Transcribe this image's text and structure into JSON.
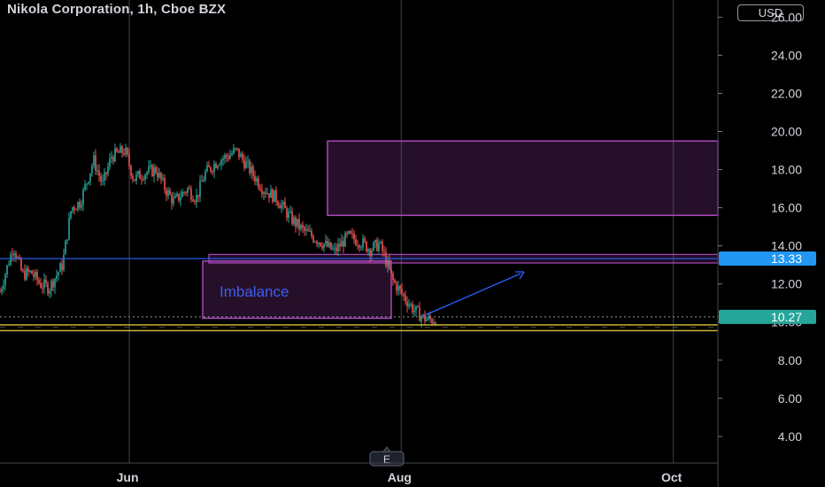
{
  "header": {
    "title": "Nikola Corporation, 1h, Cboe BZX",
    "currency": "USD"
  },
  "colors": {
    "up": "#26a69a",
    "down": "#ef5350",
    "zone": "#ab47bc",
    "hline": "#2962ff",
    "support": "#d4c33a",
    "price_tag": "#26a69a",
    "level_tag": "#2196f3"
  },
  "chart_data": {
    "type": "candlestick",
    "ylim": [
      2.6,
      26.9
    ],
    "y_ticks": [
      "26.00",
      "24.00",
      "22.00",
      "20.00",
      "18.00",
      "16.00",
      "14.00",
      "12.00",
      "10.00",
      "8.00",
      "6.00",
      "4.00"
    ],
    "x_ticks": [
      "Jun",
      "Aug",
      "Oct"
    ],
    "xlim": [
      "2021-05-03",
      "2021-10-11"
    ],
    "price_path": [
      [
        "2021-05-03",
        11.6
      ],
      [
        "2021-05-05",
        13.2
      ],
      [
        "2021-05-06",
        14.0
      ],
      [
        "2021-05-08",
        12.5
      ],
      [
        "2021-05-10",
        12.6
      ],
      [
        "2021-05-12",
        12.0
      ],
      [
        "2021-05-14",
        11.8
      ],
      [
        "2021-05-17",
        13.0
      ],
      [
        "2021-05-19",
        16.0
      ],
      [
        "2021-05-21",
        16.3
      ],
      [
        "2021-05-24",
        18.5
      ],
      [
        "2021-05-26",
        17.2
      ],
      [
        "2021-05-28",
        18.7
      ],
      [
        "2021-05-31",
        19.0
      ],
      [
        "2021-06-02",
        17.5
      ],
      [
        "2021-06-04",
        17.8
      ],
      [
        "2021-06-07",
        18.0
      ],
      [
        "2021-06-09",
        17.0
      ],
      [
        "2021-06-11",
        16.3
      ],
      [
        "2021-06-14",
        17.0
      ],
      [
        "2021-06-16",
        16.5
      ],
      [
        "2021-06-18",
        17.8
      ],
      [
        "2021-06-21",
        18.5
      ],
      [
        "2021-06-23",
        18.7
      ],
      [
        "2021-06-25",
        19.0
      ],
      [
        "2021-06-28",
        18.0
      ],
      [
        "2021-07-01",
        17.0
      ],
      [
        "2021-07-04",
        16.5
      ],
      [
        "2021-07-07",
        15.5
      ],
      [
        "2021-07-10",
        14.8
      ],
      [
        "2021-07-14",
        14.2
      ],
      [
        "2021-07-17",
        13.7
      ],
      [
        "2021-07-20",
        14.5
      ],
      [
        "2021-07-23",
        14.2
      ],
      [
        "2021-07-25",
        13.8
      ],
      [
        "2021-07-27",
        14.1
      ],
      [
        "2021-07-28",
        13.6
      ],
      [
        "2021-07-30",
        12.2
      ],
      [
        "2021-08-02",
        11.2
      ],
      [
        "2021-08-04",
        10.6
      ],
      [
        "2021-08-06",
        10.2
      ],
      [
        "2021-08-08",
        10.1
      ],
      [
        "2021-08-09",
        10.27
      ]
    ],
    "last_price": "10.27",
    "level_price": "13.33",
    "annotations": {
      "imbalance_label": "Imbalance",
      "badge": "E"
    }
  }
}
